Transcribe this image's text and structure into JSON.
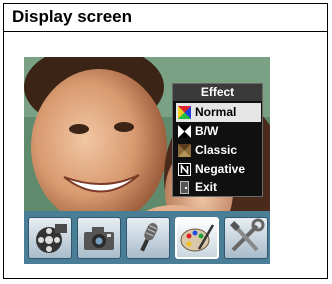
{
  "header": {
    "title": "Display screen"
  },
  "menu": {
    "title": "Effect",
    "selected_index": 0,
    "items": [
      {
        "label": "Normal",
        "icon": "normal-effect-icon"
      },
      {
        "label": "B/W",
        "icon": "bw-effect-icon"
      },
      {
        "label": "Classic",
        "icon": "classic-effect-icon"
      },
      {
        "label": "Negative",
        "icon": "negative-effect-icon"
      },
      {
        "label": "Exit",
        "icon": "exit-icon"
      }
    ]
  },
  "toolbar": {
    "active_index": 3,
    "items": [
      {
        "icon": "movie-mode-icon"
      },
      {
        "icon": "camera-mode-icon"
      },
      {
        "icon": "voice-record-icon"
      },
      {
        "icon": "effect-palette-icon"
      },
      {
        "icon": "setup-tools-icon"
      }
    ]
  },
  "colors": {
    "toolbar": "#4a7d96",
    "menu_bg": "#101010",
    "selection": "#e6e6e6"
  }
}
